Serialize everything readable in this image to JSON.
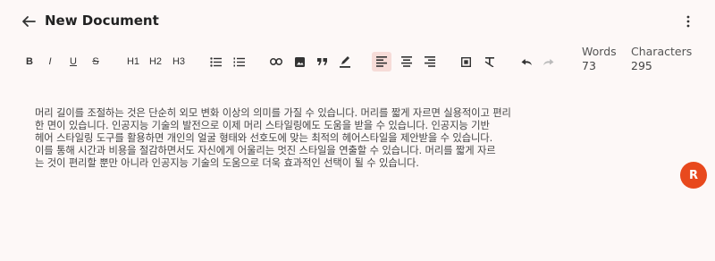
{
  "header": {
    "title": "New Document",
    "back_icon": "arrow-left-icon",
    "more_icon": "more-vertical-icon"
  },
  "toolbar": {
    "bold": "B",
    "italic": "I",
    "underline": "U",
    "strikethrough": "S",
    "h1": "H1",
    "h2": "H2",
    "h3": "H3",
    "active_button": "align-left"
  },
  "stats": {
    "words_label": "Words",
    "words_value": "73",
    "characters_label": "Characters",
    "characters_value": "295"
  },
  "editor": {
    "lines": [
      "머리 길이를 조절하는 것은 단순히 외모 변화 이상의 의미를 가질 수 있습니다. 머리를 짧게 자르면 실용적이고 편리",
      "한 면이 있습니다. 인공지능 기술의 발전으로 이제 머리 스타일링에도 도움을 받을 수 있습니다. 인공지능 기반",
      "헤어 스타일링 도구를 활용하면 개인의 얼굴 형태와 선호도에 맞는 최적의 헤어스타일을 제안받을 수 있습니다.",
      "이를 통해 시간과 비용을 절감하면서도 자신에게 어울리는 멋진 스타일을 연출할 수 있습니다. 머리를 짧게 자르",
      "는 것이 편리할 뿐만 아니라 인공지능 기술의 도움으로 더욱 효과적인 선택이 될 수 있습니다."
    ]
  },
  "avatar": {
    "initial": "R"
  },
  "colors": {
    "background": "#fdf8f7",
    "accent": "#e8491d",
    "active_highlight": "#f6dcd8"
  }
}
